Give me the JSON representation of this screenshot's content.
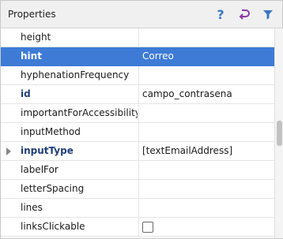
{
  "panel": {
    "title": "Properties",
    "help_symbol": "?",
    "icons": {
      "help": "help-icon",
      "restore": "restore-default-icon",
      "filter": "filter-icon"
    },
    "accent_color": "#3d7bd6"
  },
  "properties": [
    {
      "name": "height",
      "value": ""
    },
    {
      "name": "hint",
      "value": "Correo",
      "selected": true,
      "bold": true
    },
    {
      "name": "hyphenationFrequency",
      "value": ""
    },
    {
      "name": "id",
      "value": "campo_contrasena",
      "bold": true
    },
    {
      "name": "importantForAccessibility",
      "value": ""
    },
    {
      "name": "inputMethod",
      "value": ""
    },
    {
      "name": "inputType",
      "value": "[textEmailAddress]",
      "bold": true,
      "expandable": true
    },
    {
      "name": "labelFor",
      "value": ""
    },
    {
      "name": "letterSpacing",
      "value": ""
    },
    {
      "name": "lines",
      "value": ""
    },
    {
      "name": "linksClickable",
      "value": "",
      "checkbox": true,
      "checked": false
    }
  ]
}
